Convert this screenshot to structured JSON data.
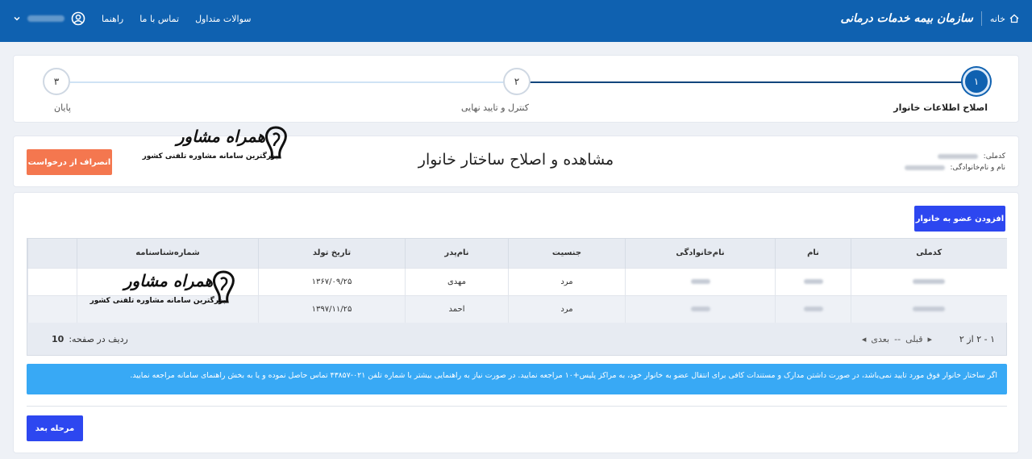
{
  "header": {
    "brand": "سازمان بیمه خدمات درمانی",
    "home_label": "خانه",
    "nav": {
      "faq": "سوالات متداول",
      "contact": "تماس با ما",
      "help": "راهنما"
    }
  },
  "stepper": {
    "steps": [
      {
        "number": "۱",
        "label": "اصلاح اطلاعات خانوار"
      },
      {
        "number": "۲",
        "label": "کنترل و تایید نهایی"
      },
      {
        "number": "۳",
        "label": "پایان"
      }
    ]
  },
  "info": {
    "title": "مشاهده و اصلاح ساختار خانوار",
    "national_code_label": "کدملی:",
    "name_label": "نام و نام‌خانوادگی:",
    "cancel_label": "انصراف از درخواست"
  },
  "watermark": {
    "title": "همراه مشاور",
    "subtitle": "بزرگترین سامانه مشاوره تلفنی کشور"
  },
  "table": {
    "add_member_label": "افزودن عضو به خانوار",
    "columns": [
      "کدملی",
      "نام",
      "نام‌خانوادگی",
      "جنسیت",
      "نام‌پدر",
      "تاریخ تولد",
      "شماره‌شناسنامه",
      ""
    ],
    "rows": [
      {
        "gender": "مرد",
        "father": "مهدی",
        "birth": "۱۳۶۷/۰۹/۲۵"
      },
      {
        "gender": "مرد",
        "father": "احمد",
        "birth": "۱۳۹۷/۱۱/۲۵"
      }
    ]
  },
  "pager": {
    "range": "۱ - ۲ از ۲",
    "prev": "قبلی",
    "separator": "--",
    "next": "بعدی",
    "page_size_label": "ردیف در صفحه:",
    "page_size": "10"
  },
  "alert": {
    "text": "اگر ساختار خانوار فوق مورد تایید نمی‌باشد، در صورت داشتن مدارک و مستندات کافی برای انتقال عضو به خانوار خود، به مراکز پلیس+۱۰ مراجعه نمایید. در صورت نیاز به راهنمایی بیشتر با شماره تلفن ۰۲۱-۴۳۸۵۷ تماس حاصل نموده و یا به بخش راهنمای سامانه مراجعه نمایید."
  },
  "footer": {
    "next_step_label": "مرحله بعد"
  },
  "colors": {
    "header_blue": "#0f61b0",
    "primary_button": "#2d47f0",
    "cancel_button": "#f4774f",
    "alert_blue": "#38a9f5"
  }
}
